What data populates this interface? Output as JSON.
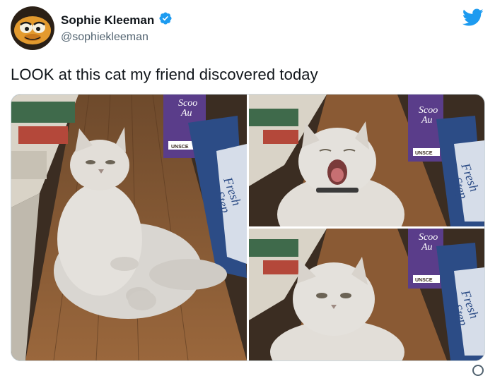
{
  "author": {
    "name": "Sophie Kleeman",
    "handle": "@sophiekleeman",
    "verified": true
  },
  "tweet": {
    "text": "LOOK at this cat my friend discovered today"
  },
  "media": {
    "photos": [
      {
        "scene": "cat-lounging"
      },
      {
        "scene": "cat-yawning"
      },
      {
        "scene": "cat-looking"
      }
    ],
    "product_text": {
      "scoop": "Scoo",
      "scoop2": "Au",
      "unscented": "UNSCE",
      "fresh": "Fresh",
      "step": "Step"
    }
  },
  "colors": {
    "brand": "#1d9bf0",
    "text": "#0f1419",
    "muted": "#536471",
    "floor": "#8a5a34",
    "product_purple": "#5a3d8a",
    "fresh_step_blue": "#2c4c86"
  },
  "icons": {
    "verified": "verified-badge-icon",
    "brand": "twitter-bird-icon"
  }
}
